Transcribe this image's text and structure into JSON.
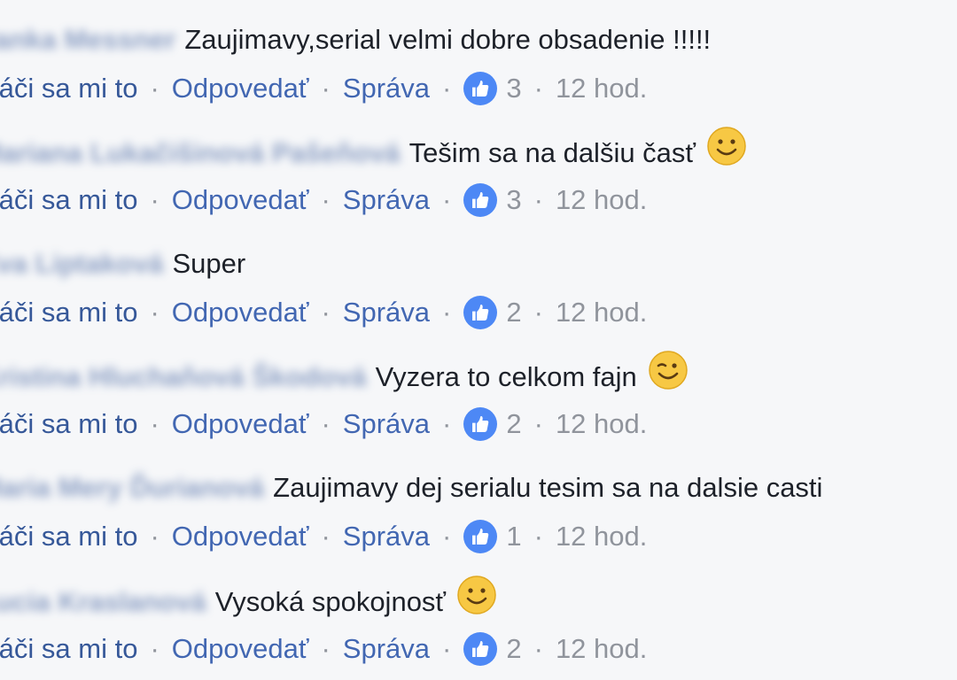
{
  "actions": {
    "like": "Páči sa mi to",
    "reply": "Odpovedať",
    "message": "Správa",
    "separator": "·"
  },
  "comments": [
    {
      "author": "Janka Messner",
      "text": "Zaujimavy,serial velmi dobre obsadenie !!!!!",
      "emoji": null,
      "likes": "3",
      "time": "12 hod."
    },
    {
      "author": "Mariana Lukačišinová Pašeňová",
      "text": "Tešim sa na dalšiu časť",
      "emoji": "smile-emoji",
      "likes": "3",
      "time": "12 hod."
    },
    {
      "author": "Eva Liptaková",
      "text": "Super",
      "emoji": null,
      "likes": "2",
      "time": "12 hod."
    },
    {
      "author": "Kristina Hluchaňová Škodová",
      "text": "Vyzera to celkom fajn",
      "emoji": "wink-emoji",
      "likes": "2",
      "time": "12 hod."
    },
    {
      "author": "Maria Mery Ďurianová",
      "text": "Zaujimavy dej serialu tesim sa na dalsie casti",
      "emoji": null,
      "likes": "1",
      "time": "12 hod."
    },
    {
      "author": "Lucia Kraslanová",
      "text": "Vysoká spokojnosť",
      "emoji": "smile-emoji",
      "likes": "2",
      "time": "12 hod."
    }
  ],
  "colors": {
    "background": "#f6f7f9",
    "author": "#365899",
    "link": "#4267b2",
    "meta": "#90949c",
    "text": "#1d2129",
    "like_badge": "#4d88f5",
    "emoji": "#f7c844"
  }
}
